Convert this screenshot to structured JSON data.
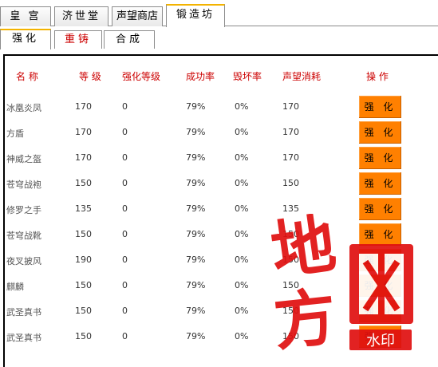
{
  "main_tabs": [
    {
      "label": "皇 宫",
      "active": false
    },
    {
      "label": "济世堂",
      "active": false
    },
    {
      "label": "声望商店",
      "active": false
    },
    {
      "label": "锻造坊",
      "active": true
    }
  ],
  "sub_tabs": [
    {
      "label": "强化",
      "active": true
    },
    {
      "label": "重铸",
      "active": false
    },
    {
      "label": "合成",
      "active": false
    }
  ],
  "table": {
    "headers": [
      "名 称",
      "等 级",
      "强化等级",
      "成功率",
      "毁坏率",
      "声望消耗",
      "操 作"
    ],
    "action_label": "强 化",
    "rows": [
      {
        "name": "冰凰炎凤",
        "level": "170",
        "enhance": "0",
        "success": "79%",
        "destroy": "0%",
        "cost": "170"
      },
      {
        "name": "方盾",
        "level": "170",
        "enhance": "0",
        "success": "79%",
        "destroy": "0%",
        "cost": "170"
      },
      {
        "name": "神威之盔",
        "level": "170",
        "enhance": "0",
        "success": "79%",
        "destroy": "0%",
        "cost": "170"
      },
      {
        "name": "苍穹战袍",
        "level": "150",
        "enhance": "0",
        "success": "79%",
        "destroy": "0%",
        "cost": "150"
      },
      {
        "name": "修罗之手",
        "level": "135",
        "enhance": "0",
        "success": "79%",
        "destroy": "0%",
        "cost": "135"
      },
      {
        "name": "苍穹战靴",
        "level": "150",
        "enhance": "0",
        "success": "79%",
        "destroy": "0%",
        "cost": "150"
      },
      {
        "name": "夜叉披风",
        "level": "190",
        "enhance": "0",
        "success": "79%",
        "destroy": "0%",
        "cost": "150"
      },
      {
        "name": "麒麟",
        "level": "150",
        "enhance": "0",
        "success": "79%",
        "destroy": "0%",
        "cost": "150"
      },
      {
        "name": "武圣真书",
        "level": "150",
        "enhance": "0",
        "success": "79%",
        "destroy": "0%",
        "cost": "150"
      },
      {
        "name": "武圣真书",
        "level": "150",
        "enhance": "0",
        "success": "79%",
        "destroy": "0%",
        "cost": "150"
      }
    ]
  },
  "watermark": {
    "text": "地方网",
    "stamp": "水印"
  },
  "colors": {
    "accent": "#f3b300",
    "header_text": "#cc0000",
    "button": "#ff8000",
    "watermark": "#e01010"
  }
}
